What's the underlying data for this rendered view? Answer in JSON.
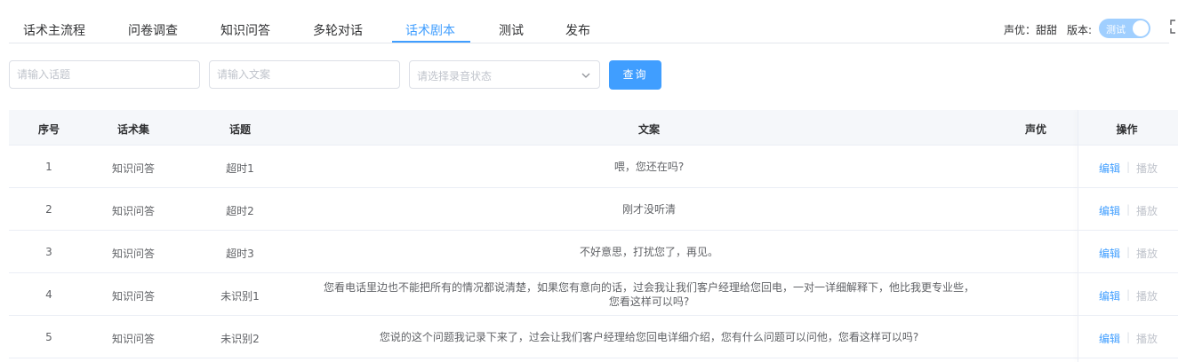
{
  "tabs": [
    {
      "label": "话术主流程",
      "active": false
    },
    {
      "label": "问卷调查",
      "active": false
    },
    {
      "label": "知识问答",
      "active": false
    },
    {
      "label": "多轮对话",
      "active": false
    },
    {
      "label": "话术剧本",
      "active": true
    },
    {
      "label": "测试",
      "active": false
    },
    {
      "label": "发布",
      "active": false
    }
  ],
  "header": {
    "voice_label": "声优：甜甜",
    "version_label": "版本:",
    "version_toggle_text": "测试"
  },
  "filters": {
    "topic_placeholder": "请输入话题",
    "copy_placeholder": "请输入文案",
    "record_status_placeholder": "请选择录音状态",
    "query_label": "查询"
  },
  "table": {
    "columns": [
      "序号",
      "话术集",
      "话题",
      "文案",
      "声优",
      "操作"
    ],
    "rows": [
      {
        "index": "1",
        "set": "知识问答",
        "topic": "超时1",
        "copy": "喂，您还在吗?",
        "copy2": "",
        "voice": "",
        "edit": "编辑",
        "play": "播放"
      },
      {
        "index": "2",
        "set": "知识问答",
        "topic": "超时2",
        "copy": "刚才没听清",
        "copy2": "",
        "voice": "",
        "edit": "编辑",
        "play": "播放"
      },
      {
        "index": "3",
        "set": "知识问答",
        "topic": "超时3",
        "copy": "不好意思，打扰您了，再见。",
        "copy2": "",
        "voice": "",
        "edit": "编辑",
        "play": "播放"
      },
      {
        "index": "4",
        "set": "知识问答",
        "topic": "未识别1",
        "copy": "您看电话里边也不能把所有的情况都说清楚，如果您有意向的话，过会我让我们客户经理给您回电，一对一详细解释下，他比我更专业些，",
        "copy2": "您看这样可以吗?",
        "voice": "",
        "edit": "编辑",
        "play": "播放"
      },
      {
        "index": "5",
        "set": "知识问答",
        "topic": "未识别2",
        "copy": "您说的这个问题我记录下来了，过会让我们客户经理给您回电详细介绍，您有什么问题可以问他，您看这样可以吗?",
        "copy2": "",
        "voice": "",
        "edit": "编辑",
        "play": "播放"
      }
    ]
  },
  "colors": {
    "accent": "#409eff",
    "toggle_bg": "#a0cfff",
    "disabled_text": "#c0c4cc"
  },
  "icons": {
    "select_arrow": "chevron-down-icon",
    "fullscreen": "fullscreen-icon"
  }
}
